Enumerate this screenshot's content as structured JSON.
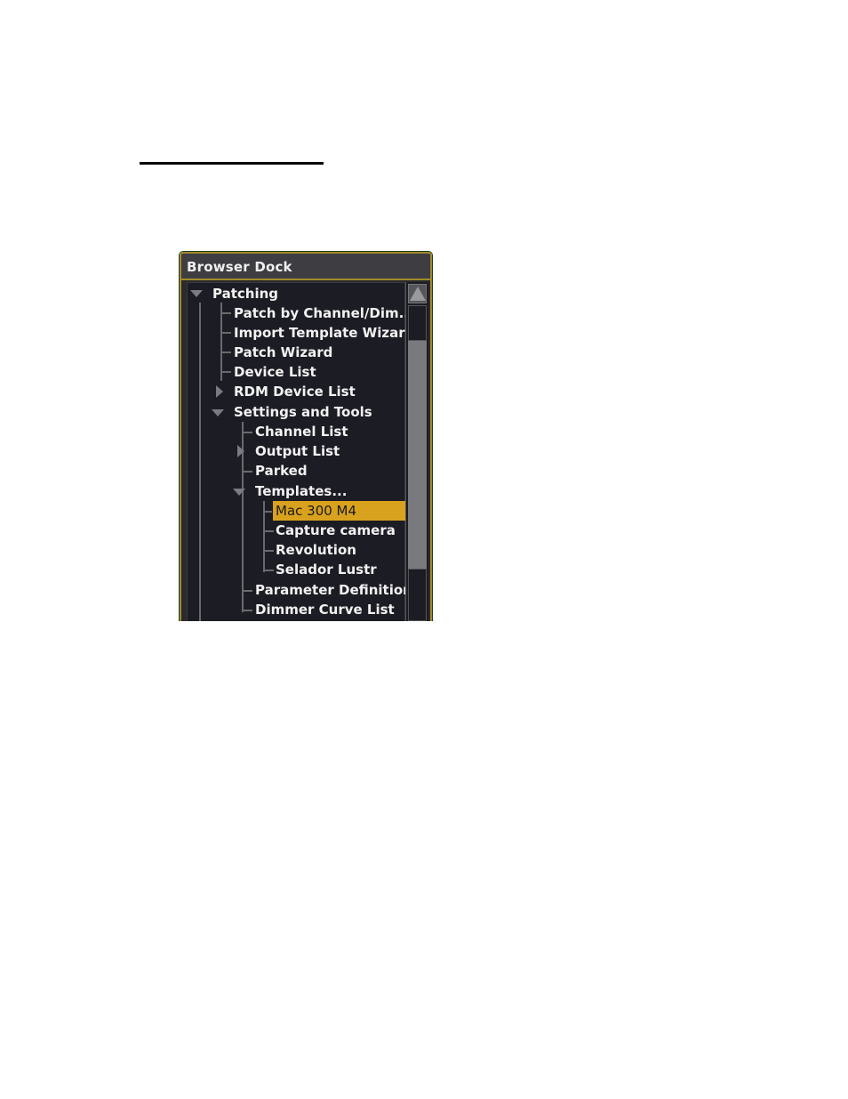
{
  "dock": {
    "title": "Browser Dock",
    "items": [
      {
        "label": "Patching",
        "level": 0,
        "expander": "expanded"
      },
      {
        "label": "Patch by Channel/Dim...",
        "level": 1,
        "expander": "none"
      },
      {
        "label": "Import Template Wizard",
        "level": 1,
        "expander": "none"
      },
      {
        "label": "Patch Wizard",
        "level": 1,
        "expander": "none"
      },
      {
        "label": "Device List",
        "level": 1,
        "expander": "none"
      },
      {
        "label": "RDM Device List",
        "level": 1,
        "expander": "collapsed"
      },
      {
        "label": "Settings and Tools",
        "level": 1,
        "expander": "expanded"
      },
      {
        "label": "Channel List",
        "level": 2,
        "expander": "none"
      },
      {
        "label": "Output List",
        "level": 2,
        "expander": "collapsed"
      },
      {
        "label": "Parked",
        "level": 2,
        "expander": "none"
      },
      {
        "label": "Templates...",
        "level": 2,
        "expander": "expanded"
      },
      {
        "label": "Mac 300 M4",
        "level": 3,
        "expander": "none",
        "selected": true
      },
      {
        "label": "Capture camera",
        "level": 3,
        "expander": "none"
      },
      {
        "label": "Revolution",
        "level": 3,
        "expander": "none"
      },
      {
        "label": "Selador Lustr",
        "level": 3,
        "expander": "none"
      },
      {
        "label": "Parameter Definitions",
        "level": 2,
        "expander": "none"
      },
      {
        "label": "Dimmer Curve List",
        "level": 2,
        "expander": "none"
      }
    ],
    "colors": {
      "accent_border": "#a08a2a",
      "selection": "#d9a21e",
      "background": "#1c1c24"
    }
  }
}
